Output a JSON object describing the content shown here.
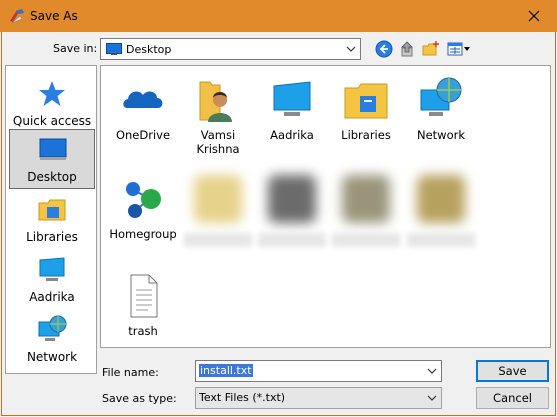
{
  "window": {
    "title": "Save As"
  },
  "toolbar": {
    "save_in_label": "Save in:",
    "location": "Desktop"
  },
  "places": [
    {
      "label": "Quick access",
      "icon": "quick-access-icon",
      "selected": false
    },
    {
      "label": "Desktop",
      "icon": "desktop-icon",
      "selected": true
    },
    {
      "label": "Libraries",
      "icon": "libraries-icon",
      "selected": false
    },
    {
      "label": "Aadrika",
      "icon": "computer-icon",
      "selected": false
    },
    {
      "label": "Network",
      "icon": "network-icon",
      "selected": false
    }
  ],
  "files": [
    {
      "label": "OneDrive",
      "icon": "onedrive-icon"
    },
    {
      "label": "Vamsi Krishna",
      "icon": "user-folder-icon"
    },
    {
      "label": "Aadrika",
      "icon": "computer-icon"
    },
    {
      "label": "Libraries",
      "icon": "libraries-icon"
    },
    {
      "label": "Network",
      "icon": "network-icon"
    },
    {
      "label": "Homegroup",
      "icon": "homegroup-icon"
    },
    {
      "label": "trash",
      "icon": "text-file-icon"
    }
  ],
  "form": {
    "file_name_label": "File name:",
    "file_name_value": "install.txt",
    "save_type_label": "Save as type:",
    "save_type_value": "Text Files (*.txt)"
  },
  "buttons": {
    "save": "Save",
    "cancel": "Cancel"
  }
}
